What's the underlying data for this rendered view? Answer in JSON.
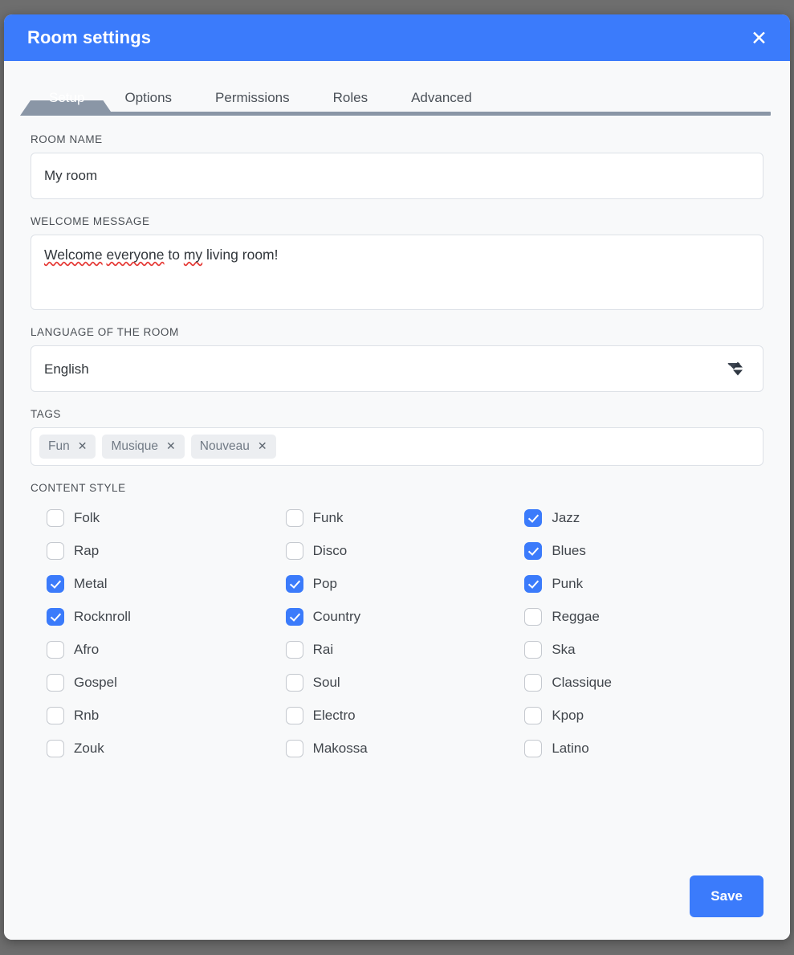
{
  "window": {
    "title": "Room settings",
    "close_icon": "close-icon",
    "header_color": "#3b7bfb",
    "accent_color": "#3b7bfb",
    "active_tab_color": "#8a96a6"
  },
  "tabs": [
    {
      "label": "Setup",
      "active": true
    },
    {
      "label": "Options",
      "active": false
    },
    {
      "label": "Permissions",
      "active": false
    },
    {
      "label": "Roles",
      "active": false
    },
    {
      "label": "Advanced",
      "active": false
    }
  ],
  "fields": {
    "room_name": {
      "label": "ROOM NAME",
      "value": "My room",
      "placeholder": ""
    },
    "welcome_message": {
      "label": "WELCOME MESSAGE",
      "value": "Welcome everyone to my living room!",
      "placeholder": "",
      "segments": [
        {
          "text": "Welcome",
          "misspelled": true
        },
        {
          "text": " ",
          "misspelled": false
        },
        {
          "text": "everyone",
          "misspelled": true
        },
        {
          "text": " to ",
          "misspelled": false
        },
        {
          "text": "my",
          "misspelled": true
        },
        {
          "text": " living room!",
          "misspelled": false
        }
      ]
    },
    "language": {
      "label": "LANGUAGE OF THE ROOM",
      "value": "English",
      "options": [
        "English"
      ]
    },
    "tags": {
      "label": "TAGS",
      "items": [
        {
          "name": "Fun",
          "remove_icon": "close-icon"
        },
        {
          "name": "Musique",
          "remove_icon": "close-icon"
        },
        {
          "name": "Nouveau",
          "remove_icon": "close-icon"
        }
      ]
    },
    "content_style": {
      "label": "CONTENT STYLE",
      "items": [
        {
          "label": "Folk",
          "checked": false
        },
        {
          "label": "Rap",
          "checked": false
        },
        {
          "label": "Metal",
          "checked": true
        },
        {
          "label": "Rocknroll",
          "checked": true
        },
        {
          "label": "Afro",
          "checked": false
        },
        {
          "label": "Gospel",
          "checked": false
        },
        {
          "label": "Rnb",
          "checked": false
        },
        {
          "label": "Zouk",
          "checked": false
        },
        {
          "label": "Funk",
          "checked": false
        },
        {
          "label": "Disco",
          "checked": false
        },
        {
          "label": "Pop",
          "checked": true
        },
        {
          "label": "Country",
          "checked": true
        },
        {
          "label": "Rai",
          "checked": false
        },
        {
          "label": "Soul",
          "checked": false
        },
        {
          "label": "Electro",
          "checked": false
        },
        {
          "label": "Makossa",
          "checked": false
        },
        {
          "label": "Jazz",
          "checked": true
        },
        {
          "label": "Blues",
          "checked": true
        },
        {
          "label": "Punk",
          "checked": true
        },
        {
          "label": "Reggae",
          "checked": false
        },
        {
          "label": "Ska",
          "checked": false
        },
        {
          "label": "Classique",
          "checked": false
        },
        {
          "label": "Kpop",
          "checked": false
        },
        {
          "label": "Latino",
          "checked": false
        }
      ]
    }
  },
  "footer": {
    "save_label": "Save"
  }
}
